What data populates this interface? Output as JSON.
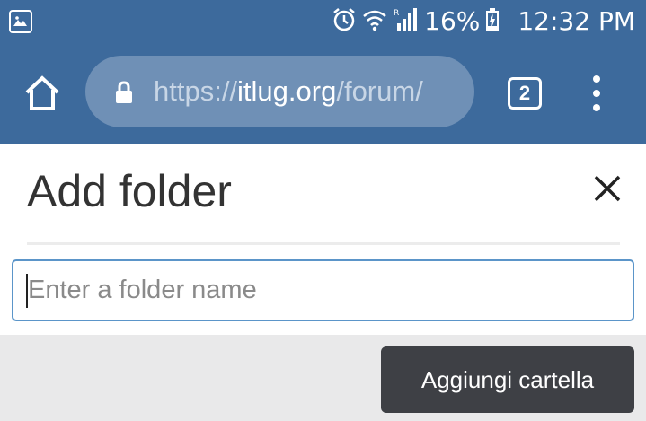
{
  "status_bar": {
    "icons": [
      "gallery-icon",
      "alarm-icon",
      "wifi-icon",
      "signal-roaming-icon",
      "battery-charging-icon"
    ],
    "battery_percent": "16%",
    "time": "12:32 PM"
  },
  "toolbar": {
    "url_scheme": "https://",
    "url_domain": "itlug.org",
    "url_path": "/forum/",
    "tab_count": "2",
    "colors": {
      "toolbar_bg": "#3d6a9c",
      "urlbar_bg": "#6f90b6"
    }
  },
  "dialog": {
    "title": "Add folder",
    "input": {
      "placeholder": "Enter a folder name",
      "value": ""
    },
    "submit_label": "Aggiungi cartella",
    "colors": {
      "input_border": "#5b95c9",
      "button_bg": "#3e4045"
    }
  }
}
